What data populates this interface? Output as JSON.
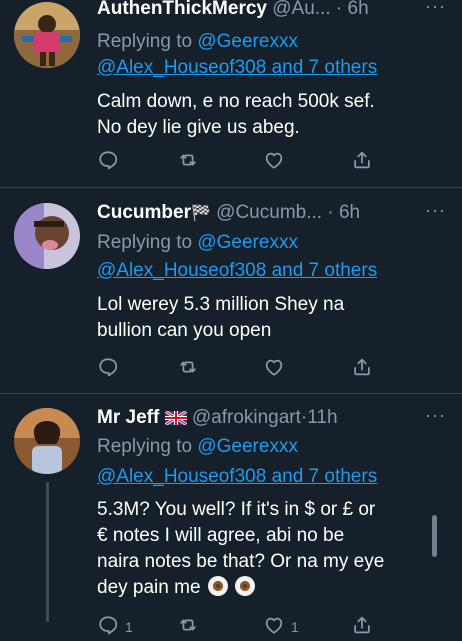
{
  "tweets": [
    {
      "name": "AuthenThickMercy",
      "handle": "@Au...",
      "sep": "·",
      "time": "6h",
      "replying_prefix": "Replying to",
      "replying_user": "@Geerexxx",
      "replying_others": "@Alex_Houseof308 and 7 others",
      "text_lines": [
        "Calm down, e no reach 500k sef.",
        "No dey lie give us abeg."
      ],
      "reply_count": "",
      "retweet_count": "",
      "like_count": ""
    },
    {
      "name": "Cucumber",
      "name_emoji": "🏁",
      "handle": "@Cucumb...",
      "sep": "·",
      "time": "6h",
      "replying_prefix": "Replying to",
      "replying_user": "@Geerexxx",
      "replying_others": "@Alex_Houseof308 and 7 others",
      "text_lines": [
        "Lol werey 5.3 million Shey na",
        "bullion can you open"
      ],
      "reply_count": "",
      "retweet_count": "",
      "like_count": ""
    },
    {
      "name": "Mr Jeff",
      "name_flag": "uk-flag-icon",
      "handle": "@afrokingart",
      "sep": "·",
      "time": "11h",
      "replying_prefix": "Replying to",
      "replying_user": "@Geerexxx",
      "replying_others": "@Alex_Houseof308 and 7 others",
      "text_lines": [
        "5.3M? You well? If it's in $ or £ or",
        "€ notes I will agree, abi no be",
        "naira notes be that? Or na my eye",
        "dey pain me"
      ],
      "reply_count": "1",
      "retweet_count": "",
      "like_count": "1"
    }
  ],
  "more_label": "···",
  "icons": {
    "reply": "reply-icon",
    "retweet": "retweet-icon",
    "like": "heart-icon",
    "share": "share-icon"
  },
  "colors": {
    "background": "#15202b",
    "text": "#ffffff",
    "secondary": "#8b98a5",
    "link": "#1d9bf0",
    "divider": "#38444d"
  }
}
